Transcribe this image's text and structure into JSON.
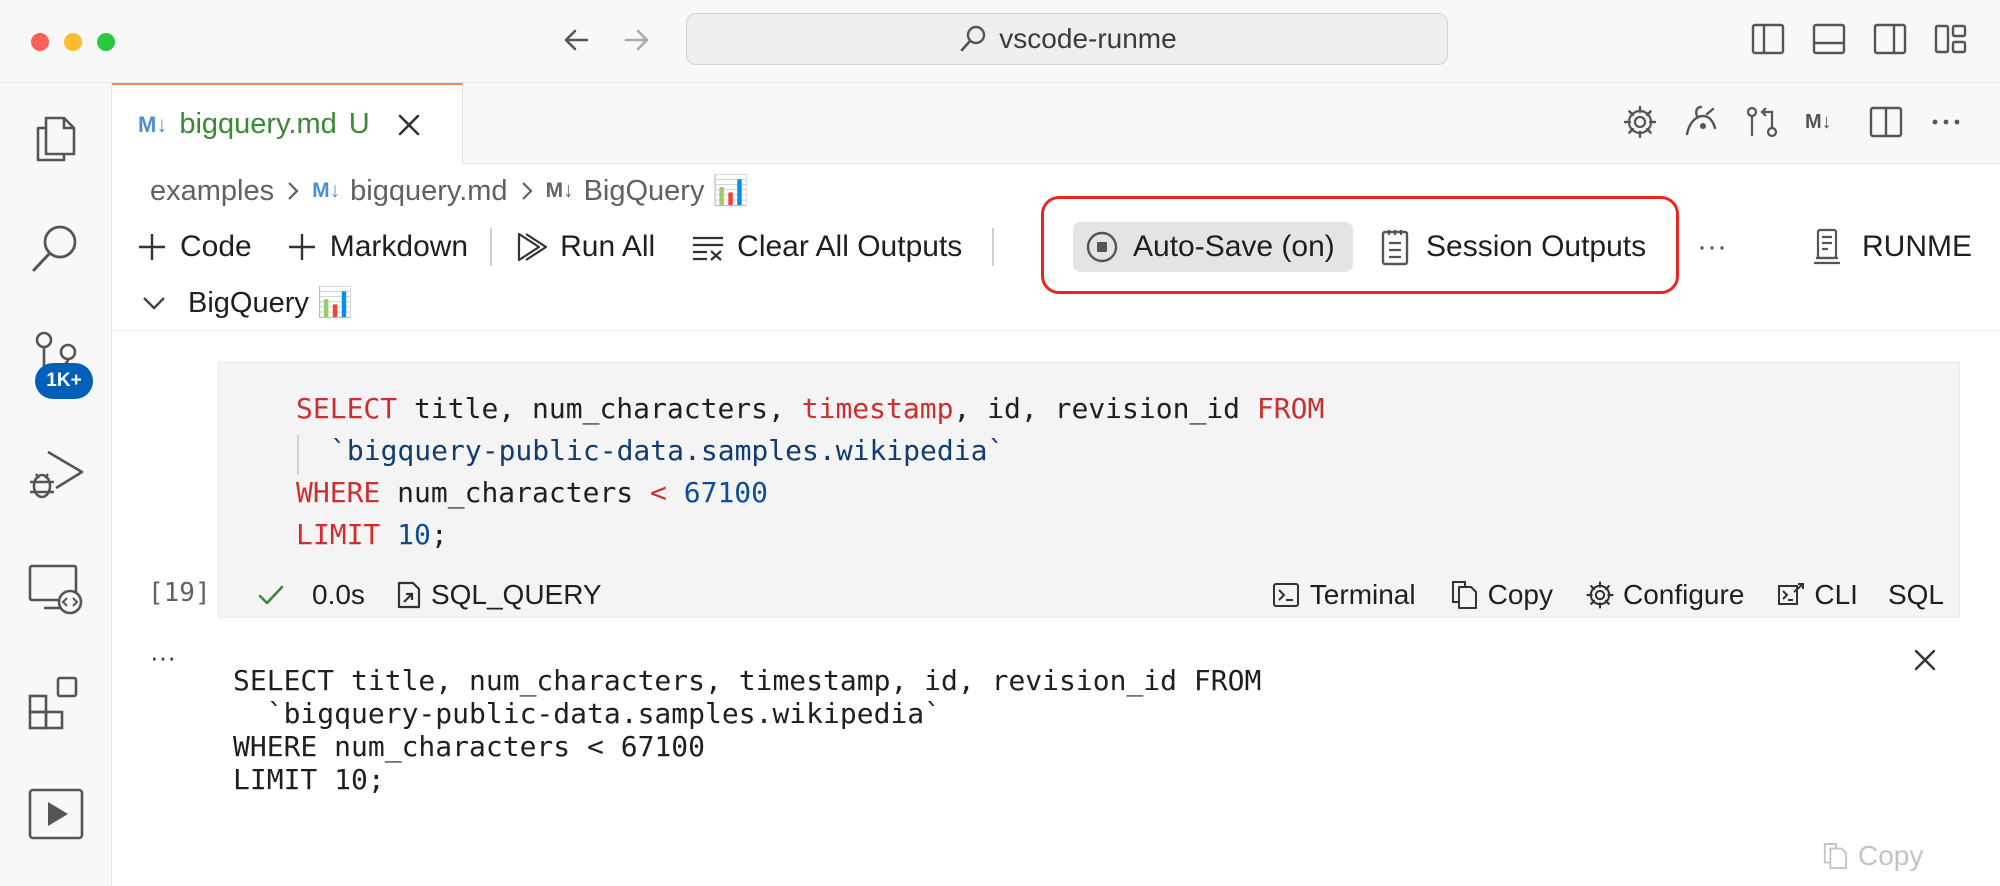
{
  "window": {
    "search": "vscode-runme"
  },
  "tab": {
    "icon": "M↓",
    "filename": "bigquery.md",
    "status": "U"
  },
  "breadcrumb": {
    "folder": "examples",
    "file": "bigquery.md",
    "heading": "BigQuery 📊",
    "md_icon": "M↓"
  },
  "editor_actions": {
    "md_label": "M↓"
  },
  "toolbar": {
    "code": "Code",
    "markdown": "Markdown",
    "run_all": "Run All",
    "clear_outputs": "Clear All Outputs",
    "auto_save": "Auto-Save (on)",
    "session_outputs": "Session Outputs",
    "more": "···",
    "runme": "RUNME"
  },
  "section": {
    "title": "BigQuery 📊"
  },
  "activity": {
    "badge": "1K+"
  },
  "cell": {
    "exec_count": "[19]",
    "duration": "0.0s",
    "name": "SQL_QUERY",
    "actions": {
      "terminal": "Terminal",
      "copy": "Copy",
      "configure": "Configure",
      "cli": "CLI",
      "language": "SQL"
    },
    "code": {
      "l1_select": "SELECT",
      "l1_mid1": " title, num_characters, ",
      "l1_ts": "timestamp",
      "l1_mid2": ", id, revision_id ",
      "l1_from": "FROM",
      "l2": "`bigquery-public-data.samples.wikipedia`",
      "l3_where": "WHERE",
      "l3_mid": " num_characters ",
      "l3_op": "<",
      "l3_sp": " ",
      "l3_num": "67100",
      "l4_limit": "LIMIT",
      "l4_sp": " ",
      "l4_num": "10",
      "l4_end": ";"
    }
  },
  "output": {
    "ellipsis": "···",
    "text": "SELECT title, num_characters, timestamp, id, revision_id FROM\n  `bigquery-public-data.samples.wikipedia`\nWHERE num_characters < 67100\nLIMIT 10;",
    "copy": "Copy"
  },
  "colors": {
    "accent_red": "#e8281d",
    "tab_green": "#388a34",
    "badge_blue": "#005fb8",
    "keyword": "#cd2f2f",
    "number": "#0b4d9b"
  }
}
